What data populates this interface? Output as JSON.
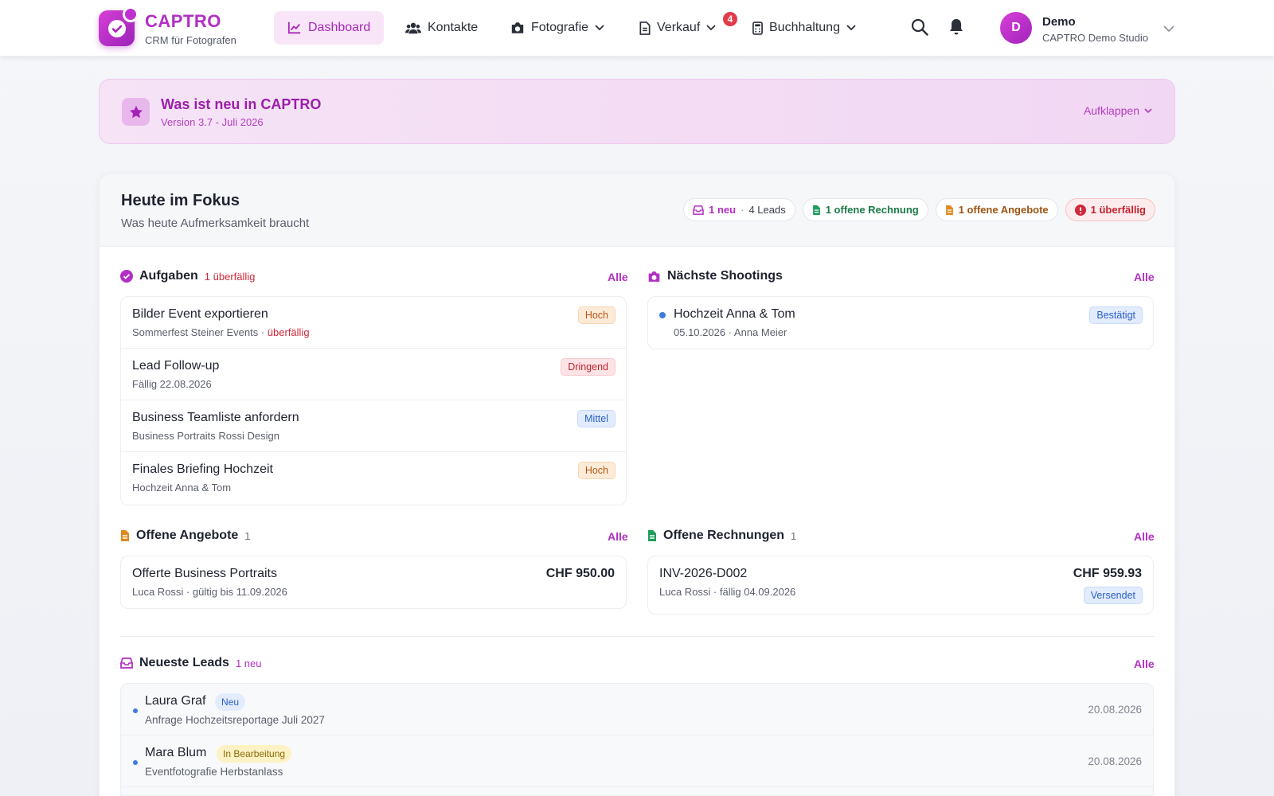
{
  "app": {
    "brand": "CAPTRO",
    "tagline": "CRM für Fotografen"
  },
  "nav": {
    "items": [
      {
        "label": "Dashboard",
        "icon": "chart-line-icon",
        "active": true
      },
      {
        "label": "Kontakte",
        "icon": "users-icon"
      },
      {
        "label": "Fotografie",
        "icon": "camera-icon"
      },
      {
        "label": "Verkauf",
        "icon": "document-icon",
        "badge": "4"
      },
      {
        "label": "Buchhaltung",
        "icon": "calculator-icon"
      }
    ]
  },
  "user": {
    "initial": "D",
    "name": "Demo",
    "studio": "CAPTRO Demo Studio"
  },
  "news": {
    "title": "Was ist neu in CAPTRO",
    "version": "Version 3.7 - Juli 2026",
    "toggle": "Aufklappen"
  },
  "focus": {
    "title": "Heute im Fokus",
    "subtitle": "Was heute Aufmerksamkeit braucht",
    "chips": {
      "leads_new": "1 neu",
      "leads_sep": "·",
      "leads_total": "4 Leads",
      "invoices": "1 offene Rechnung",
      "offers": "1 offene Angebote",
      "overdue": "1 überfällig"
    }
  },
  "tasks": {
    "title": "Aufgaben",
    "count": "1 überfällig",
    "all": "Alle",
    "items": [
      {
        "title": "Bilder Event exportieren",
        "sub": "Sommerfest Steiner Events",
        "sep": " · ",
        "overdue": "überfällig",
        "priority": "Hoch"
      },
      {
        "title": "Lead Follow-up",
        "sub": "Fällig 22.08.2026",
        "priority": "Dringend"
      },
      {
        "title": "Business Teamliste anfordern",
        "sub": "Business Portraits Rossi Design",
        "priority": "Mittel"
      },
      {
        "title": "Finales Briefing Hochzeit",
        "sub": "Hochzeit Anna & Tom",
        "priority": "Hoch"
      }
    ]
  },
  "shootings": {
    "title": "Nächste Shootings",
    "all": "Alle",
    "items": [
      {
        "title": "Hochzeit Anna & Tom",
        "sub": "05.10.2026 · Anna Meier",
        "status": "Bestätigt"
      }
    ]
  },
  "offers": {
    "title": "Offene Angebote",
    "count": "1",
    "all": "Alle",
    "items": [
      {
        "title": "Offerte Business Portraits",
        "sub": "Luca Rossi · gültig bis 11.09.2026",
        "amount": "CHF 950.00"
      }
    ]
  },
  "invoices": {
    "title": "Offene Rechnungen",
    "count": "1",
    "all": "Alle",
    "items": [
      {
        "title": "INV-2026-D002",
        "sub": "Luca Rossi · fällig 04.09.2026",
        "amount": "CHF 959.93",
        "status": "Versendet"
      }
    ]
  },
  "leads": {
    "title": "Neueste Leads",
    "count": "1 neu",
    "all": "Alle",
    "items": [
      {
        "name": "Laura Graf",
        "tag": "Neu",
        "sub": "Anfrage Hochzeitsreportage Juli 2027",
        "date": "20.08.2026"
      },
      {
        "name": "Mara Blum",
        "tag": "In Bearbeitung",
        "sub": "Eventfotografie Herbstanlass",
        "date": "20.08.2026"
      }
    ]
  },
  "colors": {
    "accent": "#b22fc4",
    "overdue": "#d0283a",
    "info": "#3d7be0"
  }
}
